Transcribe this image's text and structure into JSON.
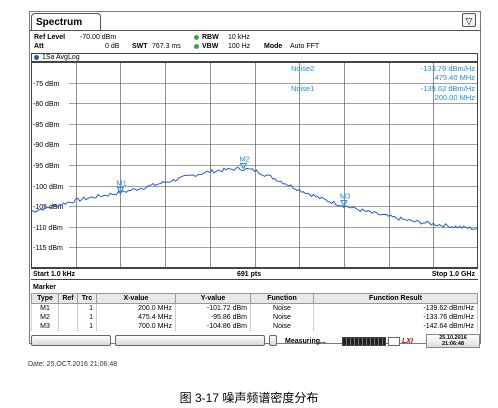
{
  "window": {
    "tab_title": "Spectrum",
    "menu_icon": "settings-menu-icon"
  },
  "settings": {
    "ref_level_label": "Ref Level",
    "ref_level_value": "-70.00 dBm",
    "att_label": "Att",
    "att_value": "0 dB",
    "swt_label": "SWT",
    "swt_value": "767.3 ms",
    "rbw_label": "RBW",
    "rbw_value": "10 kHz",
    "vbw_label": "VBW",
    "vbw_value": "100 Hz",
    "mode_label": "Mode",
    "mode_value": "Auto FFT"
  },
  "trace": {
    "label": "1Sa AvgLog"
  },
  "noise_readouts": [
    {
      "name": "Noise2",
      "value": "-133.76 dBm/Hz",
      "freq": "475.40 MHz"
    },
    {
      "name": "Noise1",
      "value": "-139.62 dBm/Hz",
      "freq": "200.00 MHz"
    }
  ],
  "freq_bar": {
    "start": "Start 1.0 kHz",
    "points": "691 pts",
    "stop": "Stop 1.0 GHz"
  },
  "marker_table": {
    "title": "Marker",
    "headers": [
      "Type",
      "Ref",
      "Trc",
      "X-value",
      "Y-value",
      "Function",
      "Function Result"
    ],
    "rows": [
      [
        "M1",
        "",
        "1",
        "200.0 MHz",
        "-101.72 dBm",
        "Noise",
        "-139.62 dBm/Hz"
      ],
      [
        "M2",
        "",
        "1",
        "475.4 MHz",
        "-95.86 dBm",
        "Noise",
        "-133.76 dBm/Hz"
      ],
      [
        "M3",
        "",
        "1",
        "700.0 MHz",
        "-104.86 dBm",
        "Noise",
        "-142.64 dBm/Hz"
      ]
    ]
  },
  "status": {
    "measuring": "Measuring...",
    "lxi": "LXI",
    "date": "25.10.2016",
    "time": "21:06:48"
  },
  "footer": {
    "date_line": "Date: 25.OCT.2016  21:06:48"
  },
  "caption": "图 3-17 噪声频谱密度分布",
  "colors": {
    "trace": "#2a5bd7",
    "marker": "#1a8fd6",
    "readout": "#1a8fd6",
    "grid": "#444444"
  },
  "chart_data": {
    "type": "line",
    "xlabel": "",
    "ylabel": "",
    "xlim_mhz": [
      0.001,
      1000
    ],
    "ylim": [
      -120,
      -70
    ],
    "y_ticks": [
      "-75 dBm",
      "-80 dBm",
      "-85 dBm",
      "-90 dBm",
      "-95 dBm",
      "-100 dBm",
      "-105 dBm",
      "-110 dBm",
      "-115 dBm"
    ],
    "y_tick_values": [
      -75,
      -80,
      -85,
      -90,
      -95,
      -100,
      -105,
      -110,
      -115
    ],
    "grid": true,
    "x_mhz": [
      0,
      50,
      100,
      150,
      200,
      250,
      300,
      350,
      400,
      450,
      475,
      500,
      550,
      600,
      650,
      700,
      750,
      800,
      850,
      900,
      950,
      1000
    ],
    "y_dbm": [
      -106.3,
      -105,
      -103.6,
      -102.6,
      -101.7,
      -100.5,
      -99.2,
      -97.8,
      -96.6,
      -96.0,
      -95.9,
      -96.3,
      -98.5,
      -101,
      -103.2,
      -104.9,
      -106.3,
      -107.5,
      -108.6,
      -109.3,
      -110.0,
      -110.5
    ],
    "markers": [
      {
        "name": "M1",
        "x_mhz": 200.0,
        "y_dbm": -101.72
      },
      {
        "name": "M2",
        "x_mhz": 475.4,
        "y_dbm": -95.86
      },
      {
        "name": "M3",
        "x_mhz": 700.0,
        "y_dbm": -104.86
      }
    ]
  }
}
